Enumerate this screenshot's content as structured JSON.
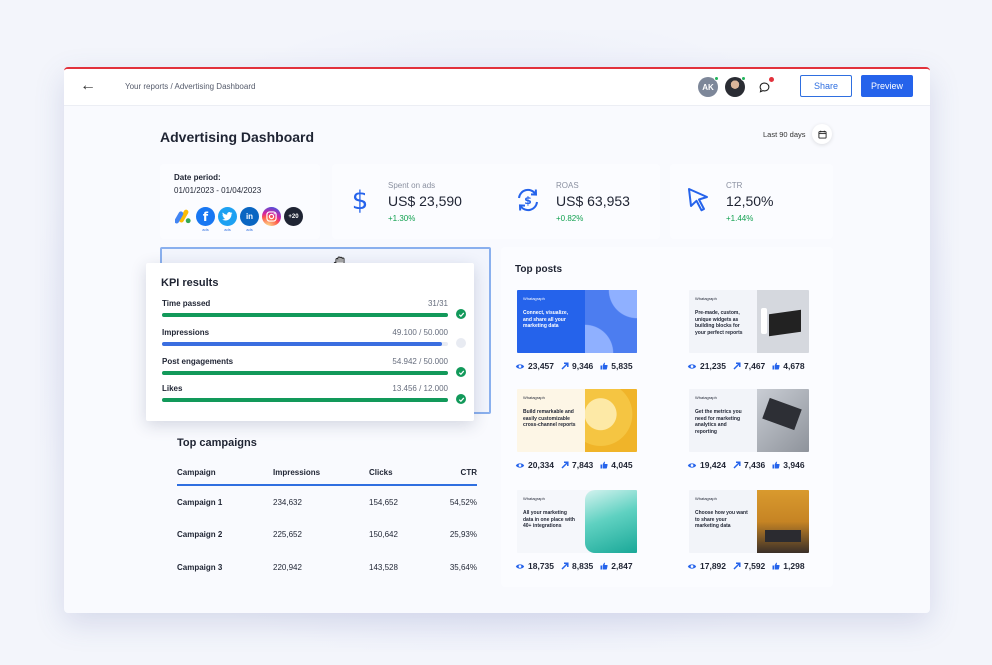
{
  "topbar": {
    "breadcrumb": "Your reports / Advertising Dashboard",
    "avatar_initials": "AK",
    "share_label": "Share",
    "preview_label": "Preview"
  },
  "header": {
    "title": "Advertising Dashboard",
    "range": "Last 90 days"
  },
  "date_card": {
    "label": "Date period:",
    "value": "01/01/2023 - 01/04/2023",
    "sources": [
      {
        "icon": "google-ads-icon"
      },
      {
        "icon": "facebook-icon",
        "sub": "ads"
      },
      {
        "icon": "twitter-icon",
        "sub": "ads"
      },
      {
        "icon": "linkedin-icon",
        "sub": "ads"
      },
      {
        "icon": "instagram-icon"
      },
      {
        "icon": "more-sources",
        "text": "+20"
      }
    ]
  },
  "metrics": [
    {
      "label": "Spent on ads",
      "value": "US$ 23,590",
      "change": "+1.30%",
      "icon": "dollar-icon"
    },
    {
      "label": "ROAS",
      "value": "US$ 63,953",
      "change": "+0.82%",
      "icon": "roas-refresh-icon"
    },
    {
      "label": "CTR",
      "value": "12,50%",
      "change": "+1.44%",
      "icon": "cursor-icon"
    }
  ],
  "kpi": {
    "title": "KPI results",
    "rows": [
      {
        "name": "Time passed",
        "value": "31/31",
        "fraction": 1.0,
        "color": "#12995a",
        "done": true
      },
      {
        "name": "Impressions",
        "value": "49.100 / 50.000",
        "fraction": 0.98,
        "color": "#3a6ee0",
        "done": false
      },
      {
        "name": "Post engagements",
        "value": "54.942 / 50.000",
        "fraction": 1.0,
        "color": "#12995a",
        "done": true
      },
      {
        "name": "Likes",
        "value": "13.456 / 12.000",
        "fraction": 1.0,
        "color": "#12995a",
        "done": true
      }
    ]
  },
  "campaigns": {
    "title": "Top campaigns",
    "headers": [
      "Campaign",
      "Impressions",
      "Clicks",
      "CTR"
    ],
    "rows": [
      [
        "Campaign 1",
        "234,632",
        "154,652",
        "54,52%"
      ],
      [
        "Campaign 2",
        "225,652",
        "150,642",
        "25,93%"
      ],
      [
        "Campaign 3",
        "220,942",
        "143,528",
        "35,64%"
      ]
    ]
  },
  "posts": {
    "title": "Top posts",
    "items": [
      {
        "brand": "Whatagraph",
        "text": "Connect, visualize, and share all your marketing data",
        "views": "23,457",
        "shares": "9,346",
        "likes": "5,835"
      },
      {
        "brand": "Whatagraph",
        "text": "Pre-made, custom, unique widgets as building blocks for your perfect reports",
        "views": "21,235",
        "shares": "7,467",
        "likes": "4,678"
      },
      {
        "brand": "Whatagraph",
        "text": "Build remarkable and easily customizable cross-channel reports",
        "views": "20,334",
        "shares": "7,843",
        "likes": "4,045"
      },
      {
        "brand": "Whatagraph",
        "text": "Get the metrics you need for marketing analytics and reporting",
        "views": "19,424",
        "shares": "7,436",
        "likes": "3,946"
      },
      {
        "brand": "Whatagraph",
        "text": "All your marketing data in one place with 40+ integrations",
        "views": "18,735",
        "shares": "8,835",
        "likes": "2,847"
      },
      {
        "brand": "Whatagraph",
        "text": "Choose how you want to share your marketing data",
        "views": "17,892",
        "shares": "7,592",
        "likes": "1,298"
      }
    ]
  }
}
